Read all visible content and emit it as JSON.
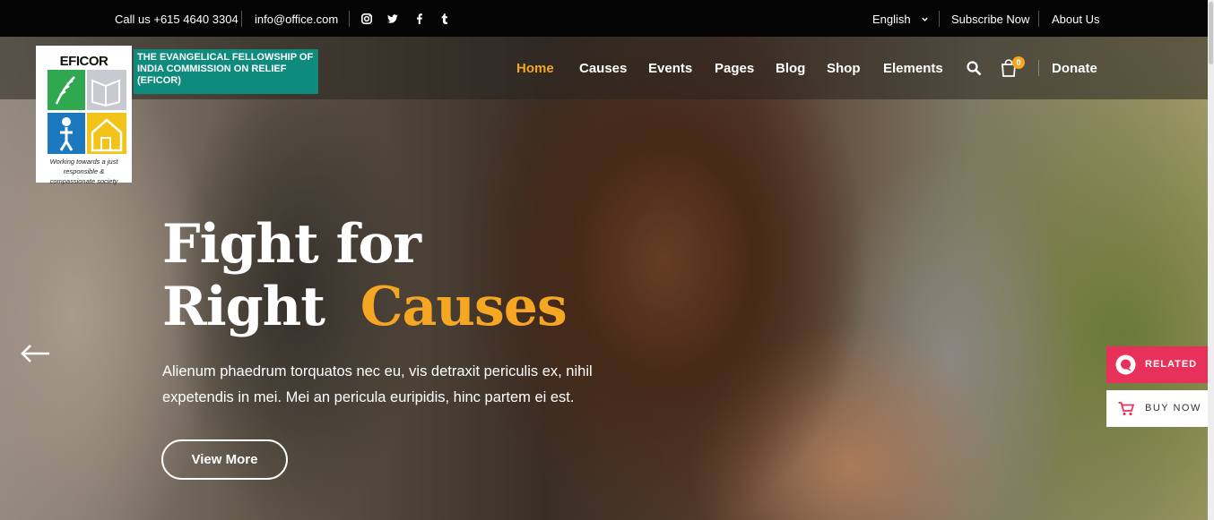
{
  "topbar": {
    "phone": "Call us +615 4640 3304",
    "email": "info@office.com",
    "social_icons": [
      "instagram-icon",
      "twitter-icon",
      "facebook-icon",
      "tumblr-icon"
    ],
    "language": "English",
    "subscribe": "Subscribe Now",
    "about": "About Us"
  },
  "logo": {
    "brand": "EFICOR",
    "org_name": "THE EVANGELICAL FELLOWSHIP OF INDIA COMMISSION ON RELIEF (EFICOR)",
    "tagline": "Working towards a just responsible & compassionate society"
  },
  "nav": {
    "items": [
      "Home",
      "Causes",
      "Events",
      "Pages",
      "Blog",
      "Shop",
      "Elements"
    ],
    "active": "Home",
    "cart_count": "0",
    "donate": "Donate"
  },
  "hero": {
    "title_line1": "Fight for",
    "title_line2": "Right",
    "title_accent": "Causes",
    "subtitle": "Alienum phaedrum torquatos nec eu, vis detraxit periculis ex, nihil expetendis in mei. Mei an pericula euripidis, hinc partem ei est.",
    "button": "View More"
  },
  "side_buttons": {
    "related": "RELATED",
    "buy_now": "BUY NOW"
  },
  "colors": {
    "accent": "#f5a623",
    "related_bg": "#e8315a",
    "org_tag_bg": "#0f8b7e"
  }
}
